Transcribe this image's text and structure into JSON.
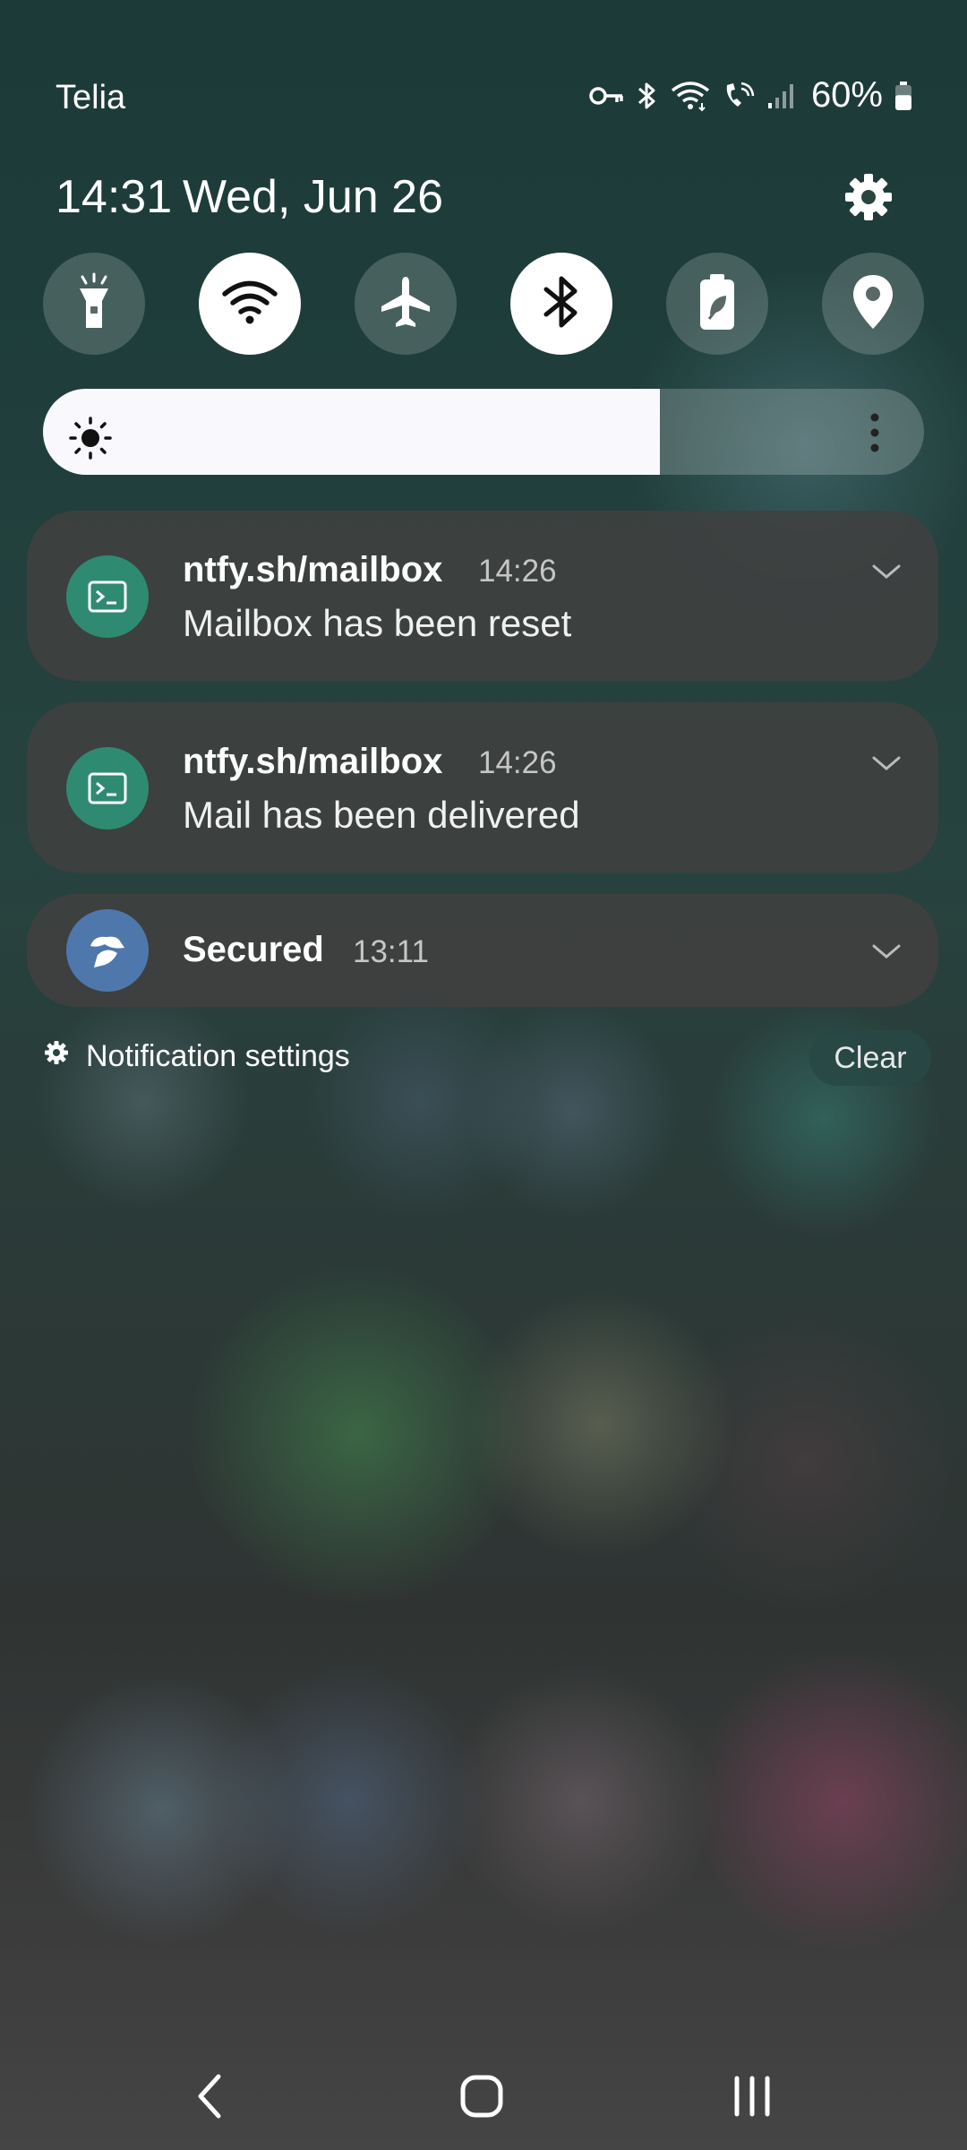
{
  "status_bar": {
    "carrier": "Telia",
    "battery_percent": "60%",
    "battery_level": 0.6,
    "icons": [
      "vpn-key-icon",
      "bluetooth-icon",
      "wifi-icon",
      "wifi-calling-icon",
      "cell-signal-icon",
      "battery-icon"
    ]
  },
  "header": {
    "time": "14:31",
    "date": "Wed, Jun 26"
  },
  "quick_tiles": [
    {
      "name": "flashlight",
      "icon": "flashlight-icon",
      "active": false
    },
    {
      "name": "wifi",
      "icon": "wifi-icon",
      "active": true
    },
    {
      "name": "airplane-mode",
      "icon": "airplane-icon",
      "active": false
    },
    {
      "name": "bluetooth",
      "icon": "bluetooth-icon",
      "active": true
    },
    {
      "name": "power-saving",
      "icon": "battery-leaf-icon",
      "active": false
    },
    {
      "name": "location",
      "icon": "location-pin-icon",
      "active": false
    }
  ],
  "brightness": {
    "level": 0.7
  },
  "notifications": [
    {
      "app": "ntfy.sh/mailbox",
      "time": "14:26",
      "message": "Mailbox has been reset",
      "icon": "terminal-icon",
      "accent": "#2f8a72"
    },
    {
      "app": "ntfy.sh/mailbox",
      "time": "14:26",
      "message": "Mail has been delivered",
      "icon": "terminal-icon",
      "accent": "#2f8a72"
    },
    {
      "app": "Secured",
      "time": "13:11",
      "message": "",
      "icon": "secured-hat-icon",
      "accent": "#4e78ab"
    }
  ],
  "footer": {
    "settings_label": "Notification settings",
    "clear_label": "Clear"
  },
  "nav_bar": {
    "buttons": [
      "back-icon",
      "home-icon",
      "recents-icon"
    ]
  }
}
